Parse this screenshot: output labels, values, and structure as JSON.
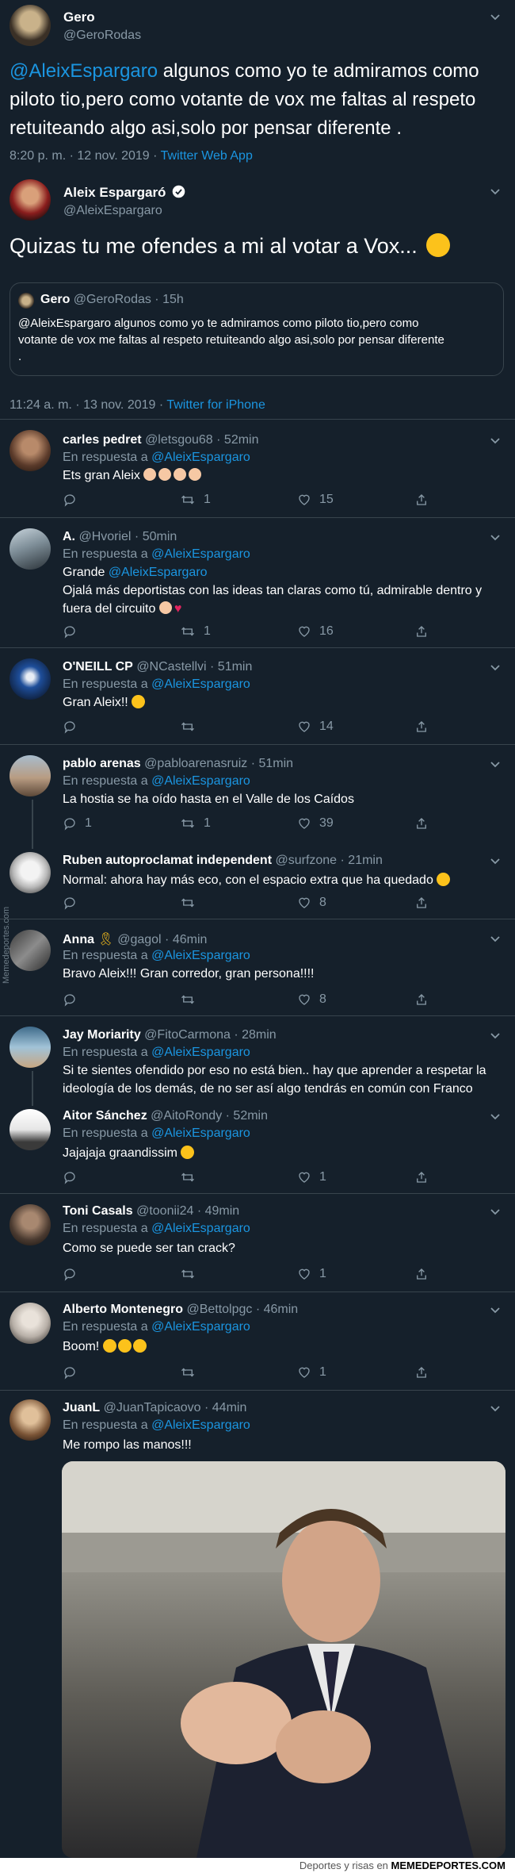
{
  "original": {
    "name": "Gero",
    "handle": "@GeroRodas",
    "text_mention": "@AleixEspargaro",
    "text_line1": "algunos como yo te admiramos como",
    "text_line2": "piloto tio,pero como votante de vox me faltas al respeto",
    "text_line3": "retuiteando algo asi,solo por pensar diferente .",
    "time": "8:20 p. m. · 12 nov. 2019 · ",
    "source": "Twitter Web App"
  },
  "aleix": {
    "name": "Aleix Espargaró",
    "handle": "@AleixEspargaro",
    "text": "Quizas tu me ofendes a mi al votar a Vox...",
    "quote": {
      "name": "Gero",
      "handle": "@GeroRodas · 15h",
      "line1": "@AleixEspargaro algunos como yo te admiramos como piloto tio,pero como",
      "line2": "votante de vox me faltas al respeto retuiteando algo asi,solo por pensar diferente",
      "line3": "."
    },
    "time": "11:24 a. m. · 13 nov. 2019 · ",
    "source": "Twitter for iPhone"
  },
  "reply_prefix": "En respuesta a ",
  "reply_target": "@AleixEspargaro",
  "replies": [
    {
      "name": "carles pedret",
      "handle": "@letsgou68 · 52min",
      "text": "Ets gran Aleix",
      "retweets": "1",
      "likes": "15"
    },
    {
      "name": "A.",
      "handle": "@Hvoriel · 50min",
      "text_prefix": "Grande ",
      "text_mention": "@AleixEspargaro",
      "text_line2": "Ojalá más deportistas con las ideas tan claras como tú, admirable dentro y",
      "text_line3": "fuera del circuito",
      "retweets": "1",
      "likes": "16"
    },
    {
      "name": "O'NEILL CP",
      "handle": "@NCastellvi · 51min",
      "text": "Gran Aleix!!",
      "retweets": "",
      "likes": "14"
    },
    {
      "name": "pablo arenas",
      "handle": "@pabloarenasruiz · 51min",
      "text": "La hostia se ha oído hasta en el Valle de los Caídos",
      "replies": "1",
      "retweets": "1",
      "likes": "39"
    },
    {
      "name": "Ruben autoproclamat independent",
      "handle": "@surfzone · 21min",
      "text": "Normal: ahora hay más eco, con el espacio extra que ha quedado",
      "likes": "8"
    },
    {
      "name": "Anna",
      "handle": "@gagol · 46min",
      "text": "Bravo Aleix!!! Gran corredor, gran persona!!!!",
      "likes": "8"
    },
    {
      "name": "Jay Moriarity",
      "handle": "@FitoCarmona · 28min",
      "text_line1": "Si te sientes ofendido por eso no está bien.. hay que aprender a respetar la",
      "text_line2": "ideología de los demás, de no ser así algo tendrás en común con Franco"
    },
    {
      "name": "Aitor Sánchez",
      "handle": "@AitoRondy · 52min",
      "text": "Jajajaja graandissim",
      "likes": "1"
    },
    {
      "name": "Toni Casals",
      "handle": "@toonii24 · 49min",
      "text": "Como se puede ser tan crack?",
      "likes": "1"
    },
    {
      "name": "Alberto Montenegro",
      "handle": "@Bettolpgc · 46min",
      "text": "Boom!",
      "likes": "1"
    },
    {
      "name": "JuanL",
      "handle": "@JuanTapicaovo · 44min",
      "text": "Me rompo las manos!!!"
    }
  ],
  "watermark_side": "Memedeportes.com",
  "footer_prefix": "Deportes y risas en ",
  "footer_brand": "MEMEDEPORTES.COM",
  "colors": {
    "background": "#15202b",
    "link": "#1b95e0",
    "muted": "#8899a6",
    "divider": "#38444d"
  }
}
